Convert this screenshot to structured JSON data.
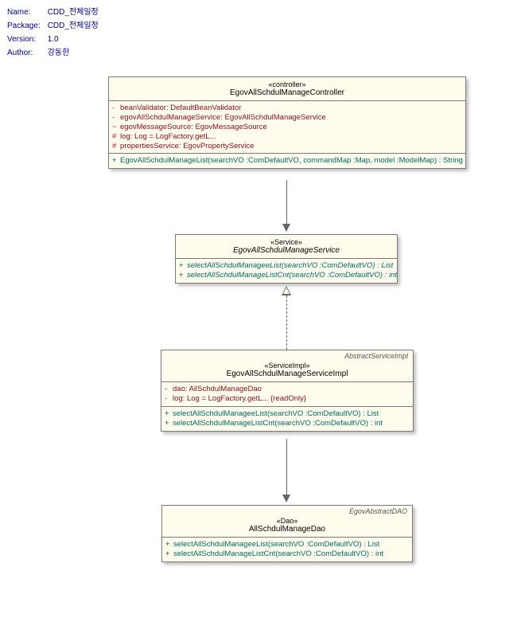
{
  "meta": {
    "name_label": "Name:",
    "name": "CDD_전체일정",
    "package_label": "Package:",
    "package": "CDD_전체일정",
    "version_label": "Version:",
    "version": "1.0",
    "author_label": "Author:",
    "author": "강동한"
  },
  "controller": {
    "stereo": "«controller»",
    "name": "EgovAllSchdulManageController",
    "attrs": [
      {
        "vis": "-",
        "text": "beanValidator:  DefaultBeanValidator"
      },
      {
        "vis": "-",
        "text": "egovAllSchdulManageService:  EgovAllSchdulManageService"
      },
      {
        "vis": "~",
        "text": "egovMessageSource:  EgovMessageSource"
      },
      {
        "vis": "#",
        "text": "log:  Log = LogFactory.getL..."
      },
      {
        "vis": "#",
        "text": "propertiesService:  EgovPropertyService"
      }
    ],
    "ops": [
      {
        "vis": "+",
        "text": "EgovAllSchdulManageList(searchVO :ComDefaultVO, commandMap :Map, model :ModelMap) : String"
      }
    ]
  },
  "service": {
    "stereo": "«Service»",
    "name": "EgovAllSchdulManageService",
    "ops": [
      {
        "vis": "+",
        "text": "selectAllSchdulManageeList(searchVO :ComDefaultVO) : List"
      },
      {
        "vis": "+",
        "text": "selectAllSchdulManageListCnt(searchVO :ComDefaultVO) : int"
      }
    ]
  },
  "serviceimpl": {
    "tag": "AbstractServiceImpl",
    "stereo": "«ServiceImpl»",
    "name": "EgovAllSchdulManageServiceImpl",
    "attrs": [
      {
        "vis": "-",
        "text": "dao:  AllSchdulManageDao"
      },
      {
        "vis": "-",
        "text": "log:  Log = LogFactory.getL... {readOnly}"
      }
    ],
    "ops": [
      {
        "vis": "+",
        "text": "selectAllSchdulManageeList(searchVO :ComDefaultVO) : List"
      },
      {
        "vis": "+",
        "text": "selectAllSchdulManageListCnt(searchVO :ComDefaultVO) : int"
      }
    ]
  },
  "dao": {
    "tag": "EgovAbstractDAO",
    "stereo": "«Dao»",
    "name": "AllSchdulManageDao",
    "ops": [
      {
        "vis": "+",
        "text": "selectAllSchdulManageeList(searchVO :ComDefaultVO) : List"
      },
      {
        "vis": "+",
        "text": "selectAllSchdulManageListCnt(searchVO :ComDefaultVO) : int"
      }
    ]
  }
}
